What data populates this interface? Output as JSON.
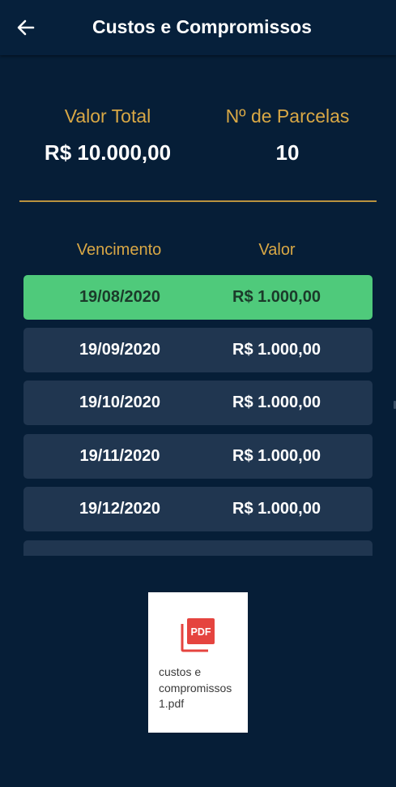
{
  "header": {
    "title": "Custos e Compromissos",
    "back_icon": "arrow-left-icon"
  },
  "summary": {
    "total_label": "Valor Total",
    "total_value": "R$ 10.000,00",
    "installments_label": "Nº de Parcelas",
    "installments_value": "10"
  },
  "table": {
    "headers": {
      "due_date": "Vencimento",
      "amount": "Valor"
    },
    "rows": [
      {
        "date": "19/08/2020",
        "amount": "R$ 1.000,00"
      },
      {
        "date": "19/09/2020",
        "amount": "R$ 1.000,00"
      },
      {
        "date": "19/10/2020",
        "amount": "R$ 1.000,00"
      },
      {
        "date": "19/11/2020",
        "amount": "R$ 1.000,00"
      },
      {
        "date": "19/12/2020",
        "amount": "R$ 1.000,00"
      },
      {
        "date": "",
        "amount": ""
      }
    ]
  },
  "attachment": {
    "icon": "pdf-file-icon",
    "badge": "PDF",
    "filename": "custos e compromissos 1.pdf"
  },
  "colors": {
    "background": "#061e37",
    "accent_gold": "#d9a845",
    "row_default": "#203650",
    "row_highlight": "#4fca7b",
    "pdf_red": "#e5443f"
  }
}
